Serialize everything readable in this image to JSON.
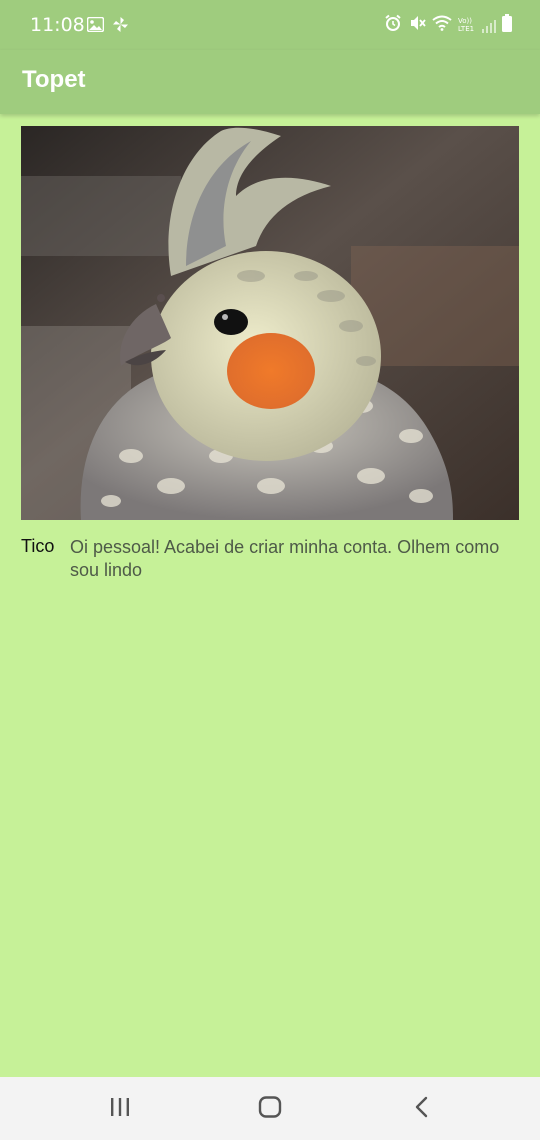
{
  "status_bar": {
    "time": "11:08",
    "left_icons": [
      "image-icon",
      "pinwheel-icon"
    ],
    "right_icons": [
      "alarm-icon",
      "mute-icon",
      "wifi-icon",
      "volte-signal-icon",
      "battery-icon"
    ],
    "volte_label": "Vo)) LTE1"
  },
  "toolbar": {
    "title": "Topet",
    "color": "#9fcc7e"
  },
  "post": {
    "image_subject": "cockatiel-photo",
    "author": "Tico",
    "text": "Oi pessoal! Acabei de criar minha conta. Olhem como sou lindo"
  },
  "nav_bar": {
    "buttons": [
      "recent-apps-icon",
      "home-icon",
      "back-icon"
    ]
  },
  "colors": {
    "background": "#c6f198",
    "toolbar": "#9fcc7e",
    "text_secondary": "#4e5a48"
  }
}
